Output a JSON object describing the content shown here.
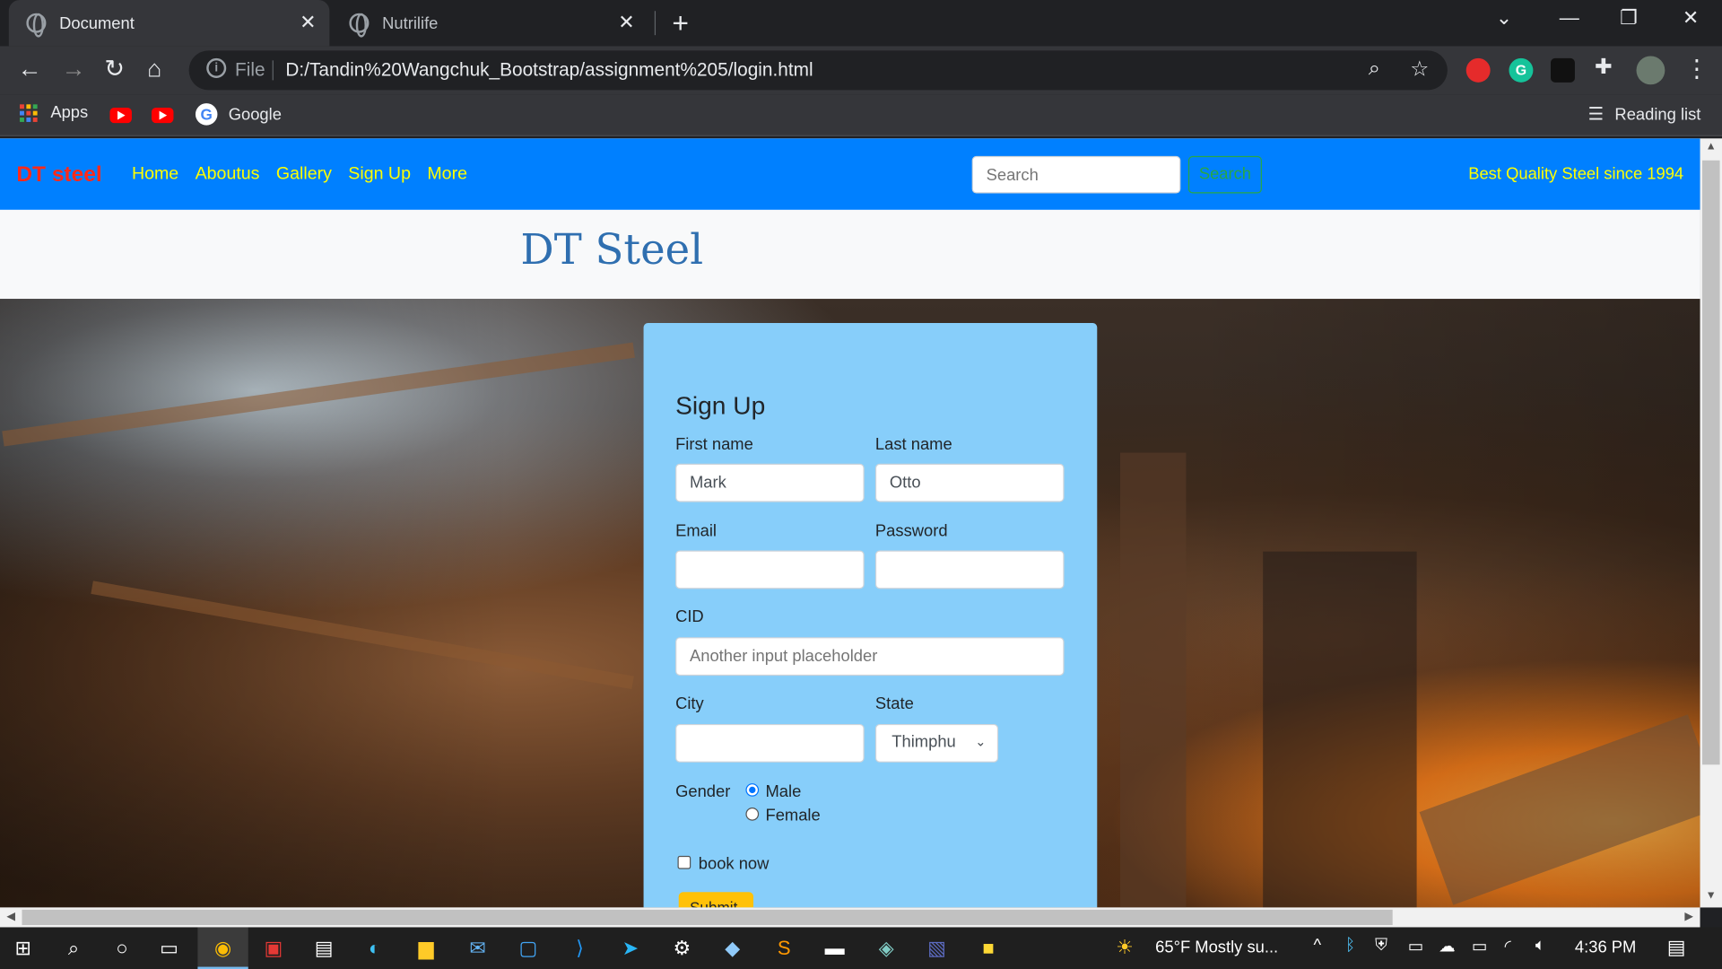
{
  "browser": {
    "tabs": [
      {
        "title": "Document",
        "active": true
      },
      {
        "title": "Nutrilife",
        "active": false
      }
    ],
    "new_tab": "+",
    "address": {
      "scheme_label": "File",
      "url": "D:/Tandin%20Wangchuk_Bootstrap/assignment%205/login.html"
    },
    "bookmarks": {
      "apps": "Apps",
      "google": "Google",
      "reading_list": "Reading list"
    }
  },
  "navbar": {
    "brand": "DT steel",
    "links": [
      "Home",
      "Aboutus",
      "Gallery",
      "Sign Up",
      "More"
    ],
    "search_placeholder": "Search",
    "search_button": "Search",
    "tagline": "Best Quality Steel since 1994",
    "colors": {
      "bar": "#0080ff",
      "links": "#ffff00",
      "brand": "#ff2a1a"
    }
  },
  "jumbotron": {
    "title": "DT Steel"
  },
  "form": {
    "title": "Sign Up",
    "first_name": {
      "label": "First name",
      "value": "Mark"
    },
    "last_name": {
      "label": "Last name",
      "value": "Otto"
    },
    "email": {
      "label": "Email",
      "value": ""
    },
    "password": {
      "label": "Password",
      "value": ""
    },
    "cid": {
      "label": "CID",
      "placeholder": "Another input placeholder"
    },
    "city": {
      "label": "City",
      "value": ""
    },
    "state": {
      "label": "State",
      "selected": "Thimphu"
    },
    "gender": {
      "label": "Gender",
      "options": [
        "Male",
        "Female"
      ],
      "selected": "Male"
    },
    "book_now": "book now",
    "submit": "Submit",
    "card_color": "#87cefa"
  },
  "taskbar": {
    "weather": "65°F  Mostly su...",
    "time": "4:36 PM"
  }
}
